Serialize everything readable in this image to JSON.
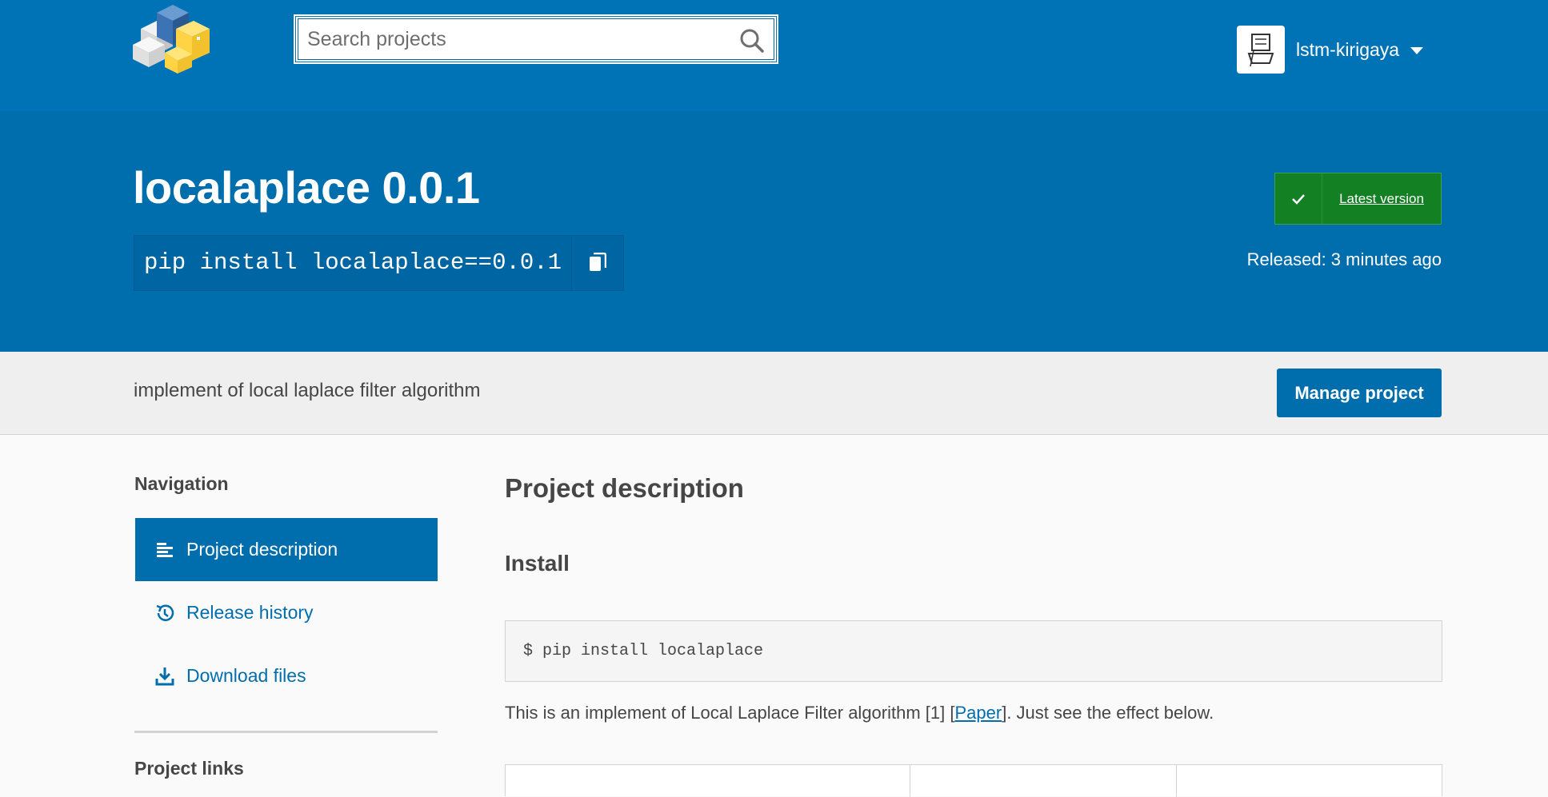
{
  "header": {
    "search_placeholder": "Search projects",
    "user": {
      "name": "lstm-kirigaya"
    }
  },
  "banner": {
    "title": "localaplace 0.0.1",
    "pip_command": "pip install localaplace==0.0.1",
    "latest_label": "Latest version",
    "released": "Released: 3 minutes ago"
  },
  "summary": {
    "text": "implement of local laplace filter algorithm",
    "manage_label": "Manage project"
  },
  "sidebar": {
    "heading": "Navigation",
    "items": [
      {
        "label": "Project description",
        "icon": "align-left-icon",
        "active": true
      },
      {
        "label": "Release history",
        "icon": "history-icon",
        "active": false
      },
      {
        "label": "Download files",
        "icon": "download-icon",
        "active": false
      }
    ],
    "links_heading": "Project links"
  },
  "main": {
    "title": "Project description",
    "install_heading": "Install",
    "install_code": "$ pip install localaplace",
    "para_before": "This is an implement of Local Laplace Filter algorithm [1] [",
    "para_link": "Paper",
    "para_after": "]. Just see the effect below."
  },
  "colors": {
    "brand_blue": "#0073b7",
    "banner_blue": "#006dad",
    "latest_green": "#148024",
    "logo_yellow": "#ffd343"
  }
}
